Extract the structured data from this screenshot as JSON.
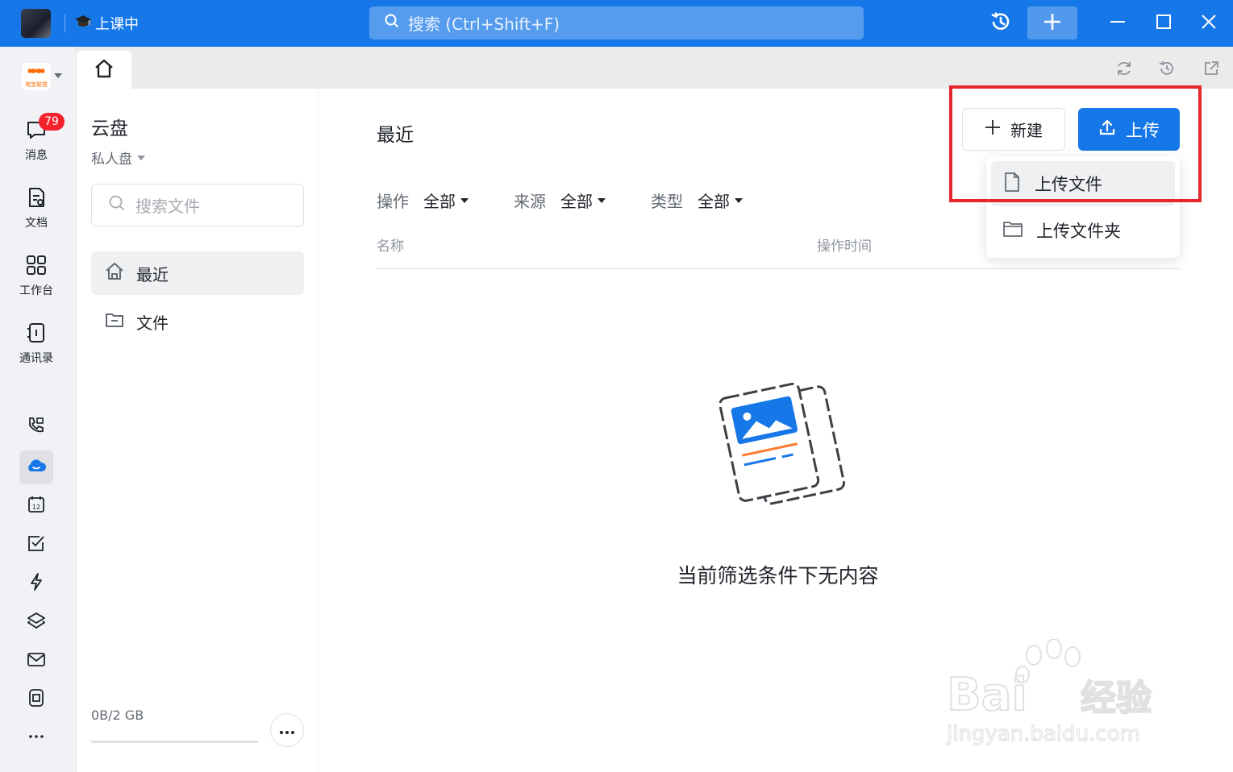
{
  "titlebar": {
    "status": "上课中",
    "search_placeholder": "搜索 (Ctrl+Shift+F)"
  },
  "sidebar": {
    "logo_text": "淘宝联盟",
    "items": [
      {
        "label": "消息",
        "badge": "79"
      },
      {
        "label": "文档"
      },
      {
        "label": "工作台"
      },
      {
        "label": "通讯录"
      }
    ]
  },
  "panel": {
    "title": "云盘",
    "subtitle": "私人盘",
    "search_placeholder": "搜索文件",
    "nav": [
      {
        "label": "最近"
      },
      {
        "label": "文件"
      }
    ],
    "quota": "0B/2 GB"
  },
  "main": {
    "title": "最近",
    "filters": [
      {
        "label": "操作",
        "value": "全部"
      },
      {
        "label": "来源",
        "value": "全部"
      },
      {
        "label": "类型",
        "value": "全部"
      }
    ],
    "columns": {
      "name": "名称",
      "time": "操作时间"
    },
    "empty_text": "当前筛选条件下无内容",
    "new_button": "新建",
    "upload_button": "上传",
    "dropdown": [
      {
        "label": "上传文件"
      },
      {
        "label": "上传文件夹"
      }
    ]
  },
  "watermark": {
    "brand": "Baidu经验",
    "url": "jingyan.baidu.com"
  },
  "colors": {
    "accent": "#1677e8",
    "highlight": "#e5262c",
    "badge": "#f5222d"
  }
}
